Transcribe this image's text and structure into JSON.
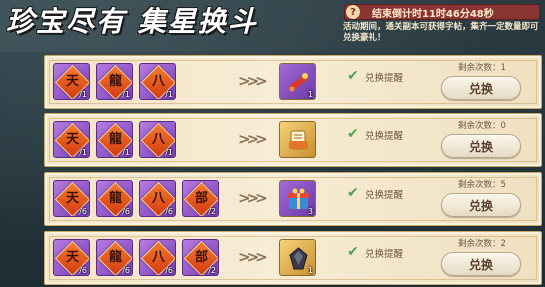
{
  "title": "珍宝尽有  集星换斗",
  "timer": {
    "help_icon": "?",
    "label": "结束倒计时11时46分48秒"
  },
  "description": "活动期间，通关副本可获得字帖，集齐一定数量即可兑换豪礼！",
  "arrow": ">>>",
  "rows": [
    {
      "costs": [
        {
          "glyph": "天",
          "count": "/1"
        },
        {
          "glyph": "龍",
          "count": "/1"
        },
        {
          "glyph": "八",
          "count": "/1"
        }
      ],
      "reward": {
        "icon": "firework-rocket-icon",
        "count": "1"
      },
      "remind_label": "兑换提醒",
      "remaining_label": "剩余次数：1",
      "button_label": "兑换"
    },
    {
      "costs": [
        {
          "glyph": "天",
          "count": "/1"
        },
        {
          "glyph": "龍",
          "count": "/1"
        },
        {
          "glyph": "八",
          "count": "/1"
        }
      ],
      "reward": {
        "icon": "scroll-bundle-icon",
        "count": ""
      },
      "remind_label": "兑换提醒",
      "remaining_label": "剩余次数：0",
      "button_label": "兑换"
    },
    {
      "costs": [
        {
          "glyph": "天",
          "count": "/6"
        },
        {
          "glyph": "龍",
          "count": "/6"
        },
        {
          "glyph": "八",
          "count": "/6"
        },
        {
          "glyph": "部",
          "count": "/2"
        }
      ],
      "reward": {
        "icon": "gift-box-icon",
        "count": "3"
      },
      "remind_label": "兑换提醒",
      "remaining_label": "剩余次数：5",
      "button_label": "兑换"
    },
    {
      "costs": [
        {
          "glyph": "天",
          "count": "/6"
        },
        {
          "glyph": "龍",
          "count": "/6"
        },
        {
          "glyph": "八",
          "count": "/6"
        },
        {
          "glyph": "部",
          "count": "/2"
        }
      ],
      "reward": {
        "icon": "dark-gem-icon",
        "count": "1"
      },
      "remind_label": "兑换提醒",
      "remaining_label": "剩余次数：2",
      "button_label": "兑换"
    }
  ],
  "colors": {
    "accent_red": "#8a3434",
    "check_green": "#4aa64a",
    "row_bg": "#f3e4c6"
  }
}
